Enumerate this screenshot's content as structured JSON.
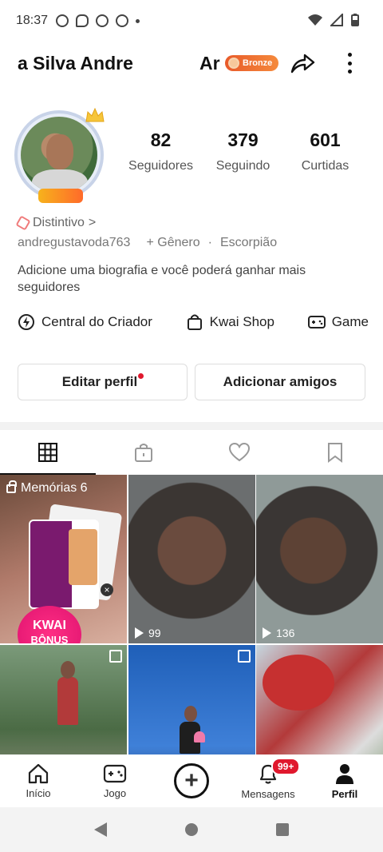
{
  "status_bar": {
    "time": "18:37",
    "icons": [
      "screen-record-icon",
      "chat-icon",
      "whatsapp-icon",
      "game-icon",
      "dot-icon"
    ],
    "right_icons": [
      "wifi-icon",
      "signal-icon",
      "battery-icon"
    ]
  },
  "header": {
    "name": "a Silva Andre",
    "name_right": "Ar",
    "badge": "Bronze"
  },
  "profile": {
    "stats": [
      {
        "num": "82",
        "label": "Seguidores"
      },
      {
        "num": "379",
        "label": "Seguindo"
      },
      {
        "num": "601",
        "label": "Curtidas"
      }
    ],
    "distintivo": "Distintivo",
    "distintivo_chevron": ">",
    "username": "andregustavoda763",
    "gender": "+ Gênero",
    "separator": "·",
    "sign": "Escorpião",
    "bio": "Adicione uma biografia e você poderá ganhar mais seguidores"
  },
  "shortcuts": [
    {
      "label": "Central do Criador",
      "icon": "creator-center-icon"
    },
    {
      "label": "Kwai Shop",
      "icon": "shopping-bag-icon"
    },
    {
      "label": "Game",
      "icon": "gamepad-icon"
    }
  ],
  "buttons": {
    "edit": "Editar perfil",
    "add": "Adicionar amigos"
  },
  "tabs": [
    "grid-icon",
    "lock-bag-icon",
    "heart-icon",
    "bookmark-icon"
  ],
  "grid": {
    "memories_label": "Memórias 6",
    "kwai": "KWAI",
    "bonus": "BÔNUS",
    "close": "×",
    "plays": [
      "99",
      "136"
    ]
  },
  "bottom_nav": {
    "items": [
      {
        "label": "Início",
        "icon": "home-icon"
      },
      {
        "label": "Jogo",
        "icon": "gamepad-icon"
      },
      {
        "label": "+",
        "icon": "plus-icon"
      },
      {
        "label": "Mensagens",
        "icon": "bell-icon"
      },
      {
        "label": "Perfil",
        "icon": "person-icon"
      }
    ],
    "badge": "99+"
  }
}
